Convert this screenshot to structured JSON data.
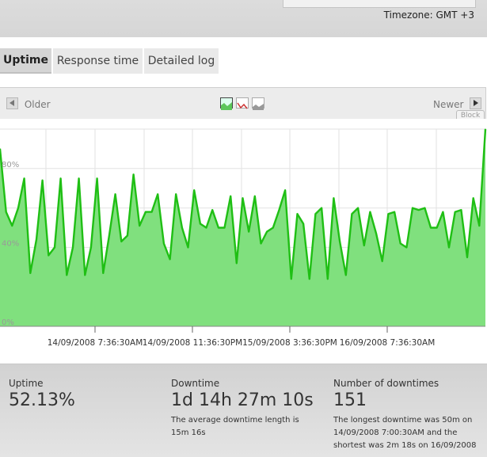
{
  "header": {
    "timezone": "Timezone: GMT +3"
  },
  "tabs": [
    {
      "label": "Uptime",
      "active": true
    },
    {
      "label": "Response time",
      "active": false
    },
    {
      "label": "Detailed log",
      "active": false
    }
  ],
  "toolbar": {
    "older_label": "Older",
    "newer_label": "Newer",
    "chart_types": [
      "area-chart-icon",
      "line-chart-icon",
      "bar-chart-icon"
    ],
    "block_label": "Block"
  },
  "colors": {
    "fill": "#80e07e",
    "line": "#1fbf14",
    "grid": "#e2e2e2"
  },
  "chart_data": {
    "type": "area",
    "ytick_labels": [
      "0%",
      "40%",
      "80%"
    ],
    "ylim": [
      0,
      100
    ],
    "xtick_labels": [
      "14/09/2008 7:36:30AM",
      "14/09/2008 11:36:30PM",
      "15/09/2008 3:36:30PM",
      "16/09/2008 7:36:30AM"
    ],
    "grid": true,
    "series": [
      {
        "values": [
          90,
          58,
          51,
          60,
          75,
          27,
          44,
          74,
          36,
          40,
          75,
          26,
          40,
          75,
          26,
          40,
          75,
          27,
          46,
          67,
          43,
          46,
          77,
          51,
          58,
          58,
          67,
          42,
          34,
          67,
          50,
          40,
          69,
          52,
          50,
          59,
          50,
          50,
          66,
          32,
          65,
          48,
          66,
          42,
          48,
          50,
          59,
          69,
          24,
          57,
          52,
          24,
          57,
          60,
          24,
          65,
          43,
          26,
          57,
          60,
          41,
          58,
          47,
          33,
          57,
          58,
          42,
          40,
          60,
          59,
          60,
          50,
          50,
          58,
          40,
          58,
          59,
          35,
          65,
          51,
          100
        ]
      }
    ]
  },
  "stats": {
    "uptime": {
      "label": "Uptime",
      "value": "52.13%"
    },
    "downtime": {
      "label": "Downtime",
      "value": "1d 14h 27m 10s",
      "note_line1": "The average downtime length is",
      "note_line2": "15m 16s"
    },
    "downtimes": {
      "label": "Number of downtimes",
      "value": "151",
      "note_line1": "The longest downtime was 50m on",
      "note_line2": "14/09/2008 7:00:30AM and the",
      "note_line3": "shortest was 2m 18s on 16/09/2008"
    }
  }
}
